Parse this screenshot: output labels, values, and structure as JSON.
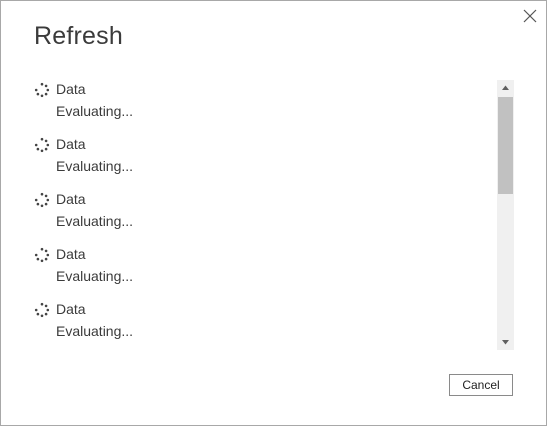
{
  "dialog": {
    "title": "Refresh",
    "close_icon": "close-icon",
    "items": [
      {
        "name": "Data",
        "status": "Evaluating...",
        "icon": "loading-spinner-icon"
      },
      {
        "name": "Data",
        "status": "Evaluating...",
        "icon": "loading-spinner-icon"
      },
      {
        "name": "Data",
        "status": "Evaluating...",
        "icon": "loading-spinner-icon"
      },
      {
        "name": "Data",
        "status": "Evaluating...",
        "icon": "loading-spinner-icon"
      },
      {
        "name": "Data",
        "status": "Evaluating...",
        "icon": "loading-spinner-icon"
      }
    ],
    "cancel_label": "Cancel"
  }
}
